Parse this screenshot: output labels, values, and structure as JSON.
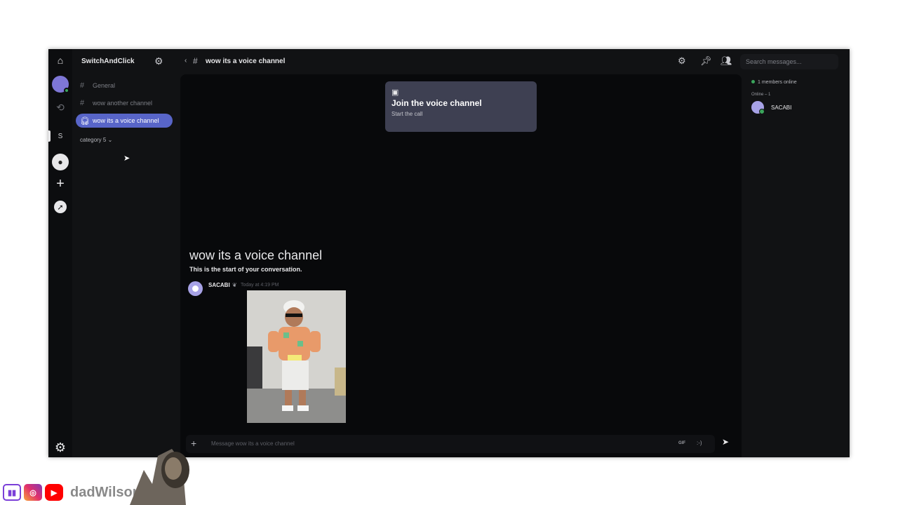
{
  "server": {
    "name": "SwitchAndClick"
  },
  "rail": {
    "active_server_initial": "S"
  },
  "channels": [
    {
      "name": "General",
      "type": "text",
      "active": false
    },
    {
      "name": "wow another channel",
      "type": "text",
      "active": false
    },
    {
      "name": "wow its a voice channel",
      "type": "voice",
      "active": true
    }
  ],
  "category": {
    "label": "category 5",
    "chevron": "⌄"
  },
  "header": {
    "title": "wow its a voice channel",
    "search_placeholder": "Search messages..."
  },
  "voice_card": {
    "title": "Join the voice channel",
    "subtitle": "Start the call"
  },
  "conversation": {
    "title": "wow its a voice channel",
    "subtitle": "This is the start of your conversation."
  },
  "message": {
    "author": "SACABI",
    "timestamp": "Today at 4:19 PM"
  },
  "composer": {
    "placeholder": "Message wow its a voice channel",
    "gif_label": "GIF",
    "emoji_label": ":-)"
  },
  "members": {
    "online_count": "1 members online",
    "online_label": "Online – 1",
    "list": [
      {
        "name": "SACABI"
      }
    ]
  },
  "overlay": {
    "handle": "dadWilson"
  },
  "colors": {
    "accent": "#5865c8",
    "online": "#3ba55c",
    "voice_card": "#3e4052"
  },
  "icons": [
    "home-icon",
    "avatar",
    "history-icon",
    "add-server-icon",
    "explore-icon",
    "settings-icon",
    "gear-icon",
    "hash-icon",
    "headphones-icon",
    "back-chevron-icon",
    "pin-icon",
    "members-icon",
    "chat-icon",
    "plus-icon",
    "send-icon"
  ]
}
